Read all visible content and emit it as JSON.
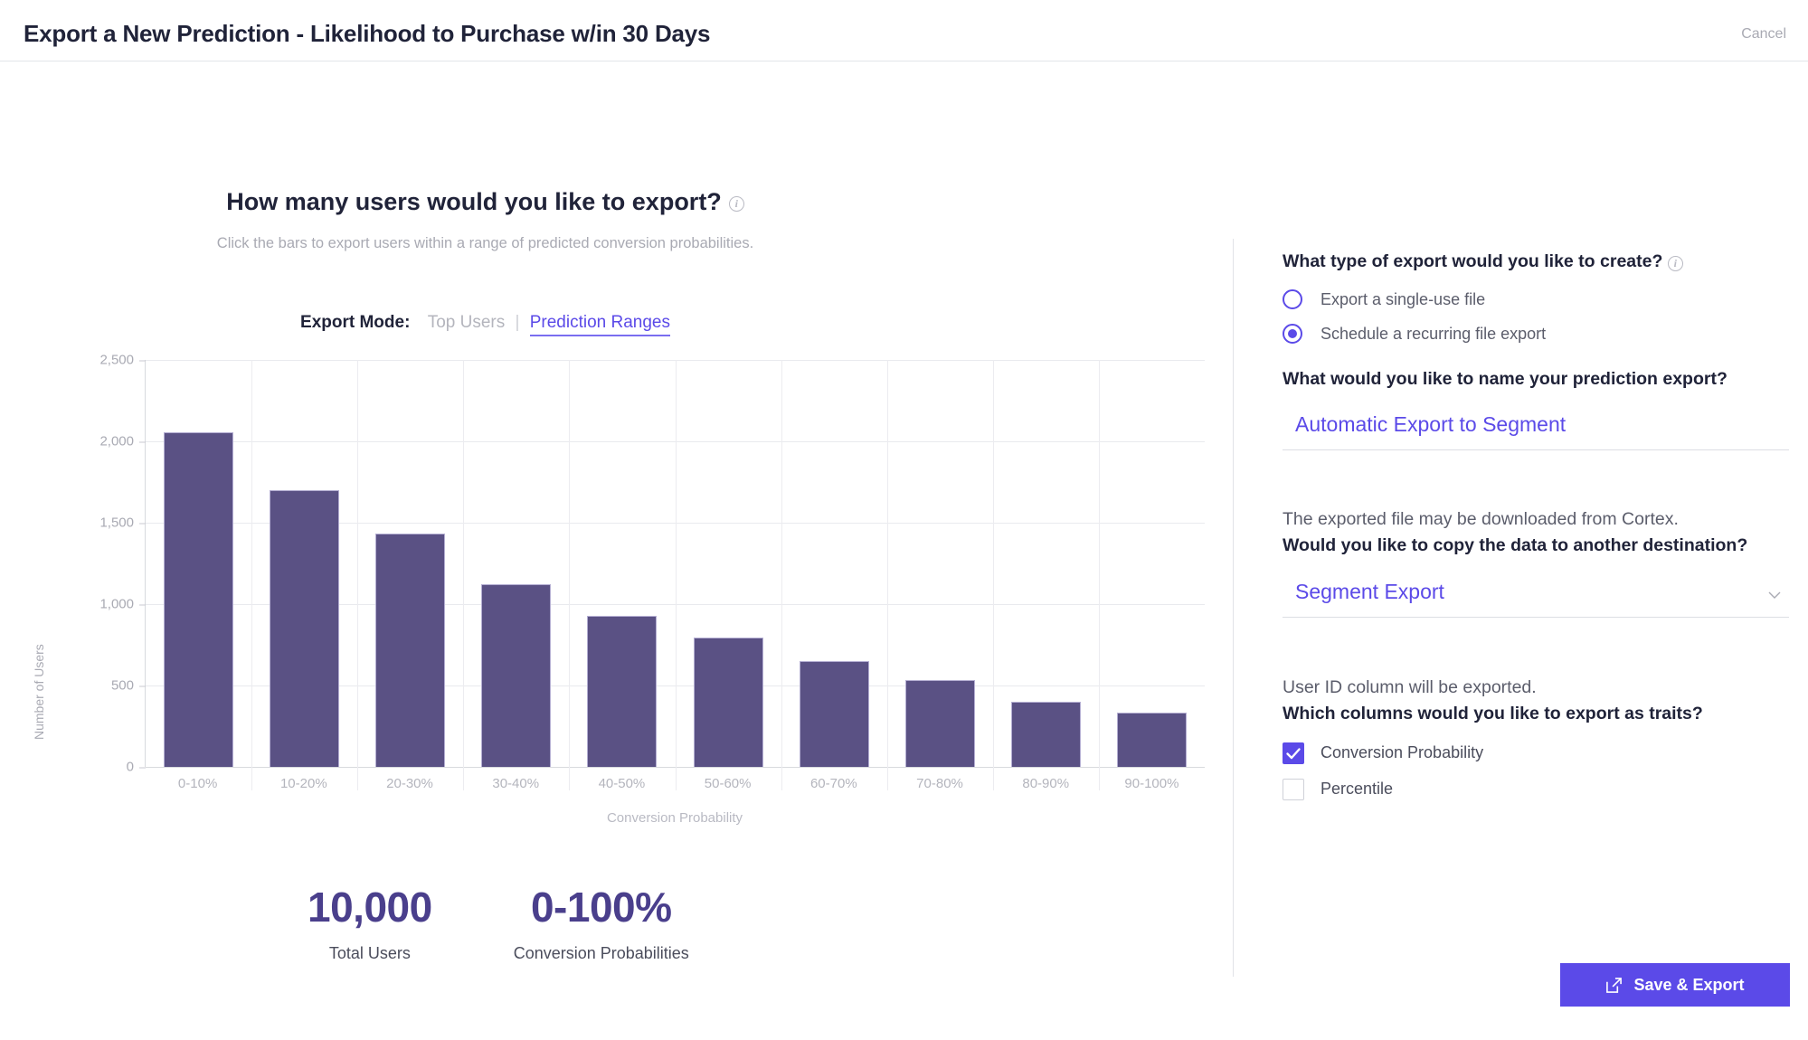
{
  "header": {
    "title": "Export a New Prediction - Likelihood to Purchase w/in 30 Days",
    "cancel_label": "Cancel"
  },
  "main": {
    "question": "How many users would you like to export?",
    "subtitle": "Click the bars to export users within a range of predicted conversion probabilities.",
    "export_mode_label": "Export Mode:",
    "export_mode_options": [
      "Top Users",
      "Prediction Ranges"
    ],
    "export_mode_selected": "Prediction Ranges",
    "separator": "|",
    "info_icon": "info-icon"
  },
  "chart_data": {
    "type": "bar",
    "title": "",
    "xlabel": "Conversion Probability",
    "ylabel": "Number of Users",
    "categories": [
      "0-10%",
      "10-20%",
      "20-30%",
      "30-40%",
      "40-50%",
      "50-60%",
      "60-70%",
      "70-80%",
      "80-90%",
      "90-100%"
    ],
    "values": [
      2055,
      1700,
      1435,
      1125,
      930,
      795,
      650,
      535,
      400,
      335
    ],
    "ylim": [
      0,
      2500
    ],
    "yticks": [
      0,
      500,
      1000,
      1500,
      2000,
      2500
    ],
    "ytick_labels": [
      "0",
      "500",
      "1,000",
      "1,500",
      "2,000",
      "2,500"
    ],
    "grid": true,
    "legend": false,
    "bar_color": "#5a5184",
    "bar_border_color": "#b4aed2"
  },
  "stats": [
    {
      "value": "10,000",
      "label": "Total Users"
    },
    {
      "value": "0-100%",
      "label": "Conversion Probabilities"
    }
  ],
  "panel": {
    "export_type_question": "What type of export would you like to create?",
    "export_type_info_icon": "info-icon",
    "export_type_options": [
      {
        "label": "Export a single-use file",
        "checked": false
      },
      {
        "label": "Schedule a recurring file export",
        "checked": true
      }
    ],
    "name_question": "What would you like to name your prediction export?",
    "name_value": "Automatic Export to Segment",
    "destination_line1": "The exported file may be downloaded from Cortex.",
    "destination_line2": "Would you like to copy the data to another destination?",
    "destination_value": "Segment Export",
    "destination_chevron_icon": "chevron-down-icon",
    "traits_line1": "User ID column will be exported.",
    "traits_line2": "Which columns would you like to export as traits?",
    "traits_options": [
      {
        "label": "Conversion Probability",
        "checked": true
      },
      {
        "label": "Percentile",
        "checked": false
      }
    ]
  },
  "footer": {
    "save_label": "Save & Export",
    "save_icon": "external-link-icon",
    "accent_color": "#5b4ae8"
  }
}
